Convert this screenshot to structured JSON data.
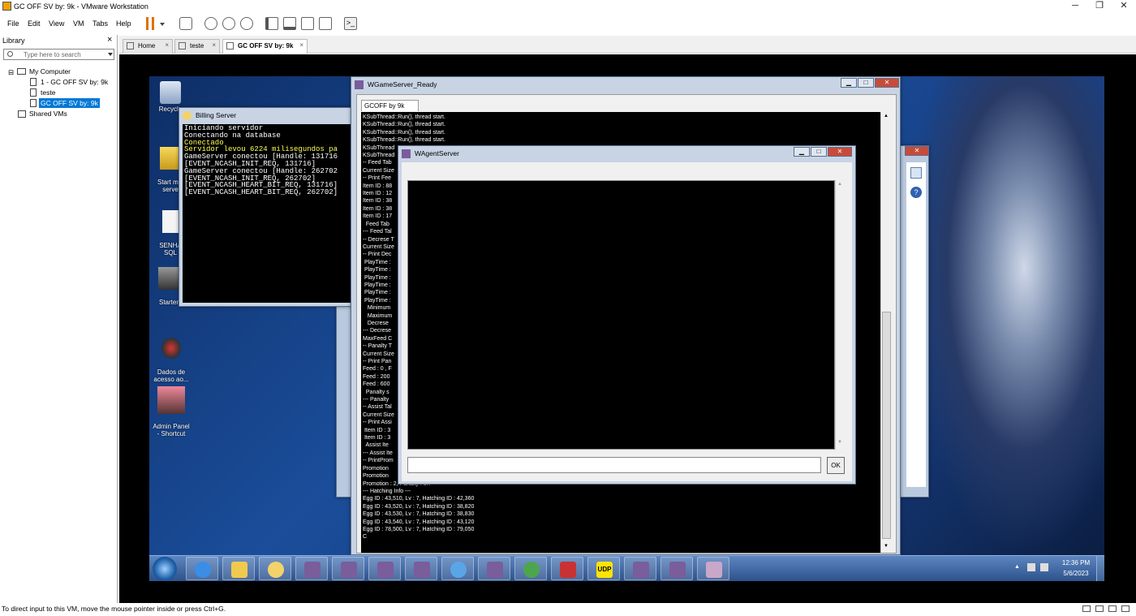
{
  "app": {
    "title": "GC OFF SV by: 9k - VMware Workstation"
  },
  "menu": [
    "File",
    "Edit",
    "View",
    "VM",
    "Tabs",
    "Help"
  ],
  "library": {
    "title": "Library",
    "close": "×",
    "search_placeholder": "Type here to search",
    "tree": {
      "root": "My Computer",
      "items": [
        "1 - GC OFF SV by: 9k",
        "teste",
        "GC OFF SV by: 9k"
      ],
      "shared": "Shared VMs"
    }
  },
  "tabs": [
    {
      "label": "Home"
    },
    {
      "label": "teste"
    },
    {
      "label": "GC OFF SV by: 9k"
    }
  ],
  "desktop_icons": [
    {
      "label": "Recycle"
    },
    {
      "label": "Start mai\nserve"
    },
    {
      "label": "SENHA\nSQL"
    },
    {
      "label": "Starter"
    },
    {
      "label": "Dados de\nacesso ao..."
    },
    {
      "label": "Admin Panel\n- Shortcut"
    }
  ],
  "billing": {
    "title": "Billing Server",
    "lines": [
      {
        "t": "Iniciando servidor",
        "c": "w"
      },
      {
        "t": "Conectando na database",
        "c": "w"
      },
      {
        "t": "Conectado",
        "c": "y"
      },
      {
        "t": "Servidor levou 6224 milisegundos pa",
        "c": "y"
      },
      {
        "t": "GameServer conectou [Handle: 131716",
        "c": "w"
      },
      {
        "t": "[EVENT_NCASH_INIT_REQ, 131716]",
        "c": "w"
      },
      {
        "t": "GameServer conectou [Handle: 262702",
        "c": "w"
      },
      {
        "t": "[EVENT_NCASH_INIT_REQ, 262702]",
        "c": "w"
      },
      {
        "t": "[EVENT_NCASH_HEART_BIT_REQ, 131716]",
        "c": "w"
      },
      {
        "t": "[EVENT_NCASH_HEART_BIT_REQ, 262702]",
        "c": "w"
      }
    ]
  },
  "gameserver": {
    "title": "WGameServer_Ready",
    "tab": "GCOFF by 9k",
    "log": [
      "KSubThread::Run(), thread start.",
      "KSubThread::Run(), thread start.",
      "KSubThread::Run(), thread start.",
      "KSubThread::Run(), thread start.",
      "KSubThread",
      "KSubThread",
      "-- Feed Tab",
      "Current Size",
      "-- Print Fee",
      "Item ID : 88",
      "Item ID : 12",
      "Item ID : 38",
      "Item ID : 38",
      "Item ID : 17",
      "  Feed Tab",
      "--- Feed Tal",
      "-- Decrese T",
      "Current Size",
      "-- Print Dec",
      " PlayTime :",
      " PlayTime :",
      " PlayTime :",
      " PlayTime :",
      " PlayTime :",
      " PlayTime :",
      "   Minimum",
      "   Maximum",
      "   Decrese",
      "--- Decrese",
      "MaxFeed C",
      "-- Panalty T",
      "Current Size",
      "-- Print Pan",
      "Feed : 0 , F",
      "Feed : 200",
      "Feed : 600",
      "  Panalty s",
      "--- Panalty",
      "-- Assist Tal",
      "Current Size",
      "-- Print Assi",
      " Item ID : 3",
      " Item ID : 3",
      "  Assist Ite",
      "--- Assist Ite",
      "-- PrintProm",
      "Promotion",
      "Promotion",
      "Promotion : 2, Panalty : 0.7",
      "--- Hatching Info ---",
      "Egg ID : 43,510, Lv : 7, Hatching ID : 42,360",
      "Egg ID : 43,520, Lv : 7, Hatching ID : 38,820",
      "Egg ID : 43,530, Lv : 7, Hatching ID : 38,830",
      "Egg ID : 43,540, Lv : 7, Hatching ID : 43,120",
      "Egg ID : 78,500, Lv : 7, Hatching ID : 79,050",
      "C"
    ]
  },
  "agent": {
    "title": "WAgentServer",
    "input_value": "",
    "ok": "OK"
  },
  "clock": {
    "time": "12:36 PM",
    "date": "5/6/2023"
  },
  "status": "To direct input to this VM, move the mouse pointer inside or press Ctrl+G.",
  "colors": {
    "desktop": "#1a4d9a",
    "taskbar": "#3a62a0",
    "selection": "#0078d7",
    "close": "#c84b3a"
  }
}
